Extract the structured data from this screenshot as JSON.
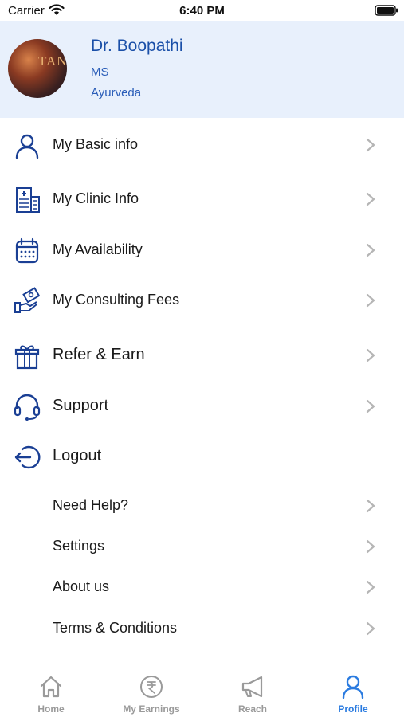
{
  "status_bar": {
    "carrier": "Carrier",
    "time": "6:40 PM"
  },
  "profile": {
    "name": "Dr. Boopathi",
    "degree": "MS",
    "specialty": "Ayurveda",
    "avatar_text": "TANI"
  },
  "menu": {
    "basic_info": "My Basic info",
    "clinic_info": "My Clinic Info",
    "availability": "My Availability",
    "consulting_fees": "My Consulting Fees",
    "refer_earn": "Refer & Earn",
    "support": "Support",
    "logout": "Logout",
    "need_help": "Need Help?",
    "settings": "Settings",
    "about_us": "About us",
    "terms": "Terms & Conditions"
  },
  "tabs": {
    "home": "Home",
    "earnings": "My Earnings",
    "reach": "Reach",
    "profile": "Profile"
  },
  "colors": {
    "accent": "#1a4fa8",
    "header_bg": "#e8f0fc",
    "tab_active": "#2a7be0",
    "tab_inactive": "#9a9a9a"
  }
}
